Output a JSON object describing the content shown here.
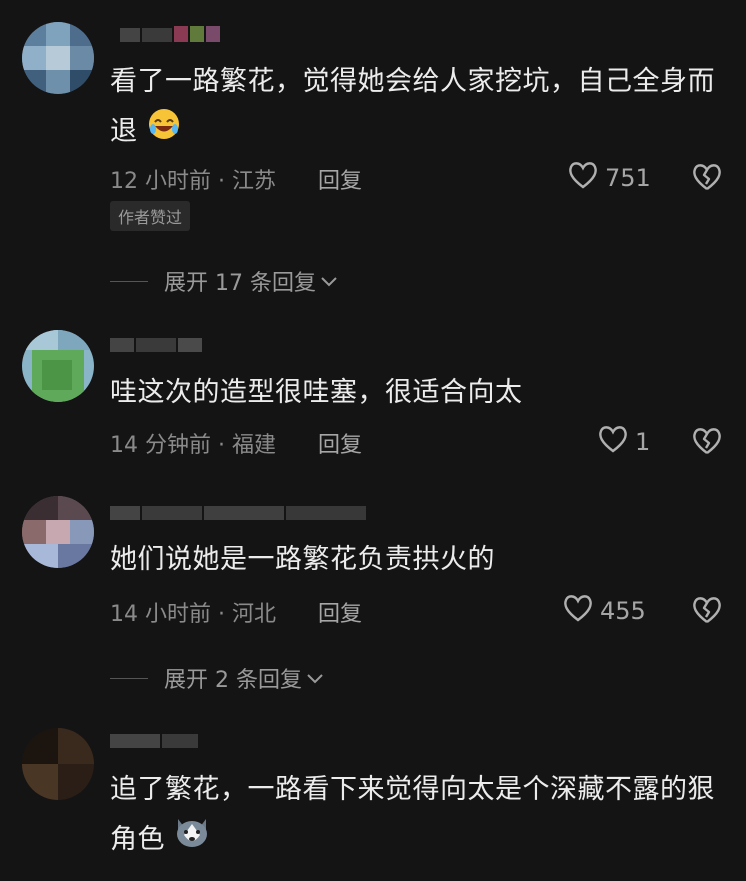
{
  "comments": [
    {
      "text": "看了一路繁花，觉得她会给人家挖坑，自己全身而退",
      "emoji": "rolling-laughing-emoji",
      "time": "12 小时前 · 江苏",
      "reply_label": "回复",
      "likes": "751",
      "badge": "作者赞过",
      "expand_label": "展开 17 条回复"
    },
    {
      "text": "哇这次的造型很哇塞，很适合向太",
      "time": "14 分钟前 · 福建",
      "reply_label": "回复",
      "likes": "1"
    },
    {
      "text": "她们说她是一路繁花负责拱火的",
      "time": "14 小时前 · 河北",
      "reply_label": "回复",
      "likes": "455",
      "expand_label": "展开 2 条回复"
    },
    {
      "text": "追了繁花，一路看下来觉得向太是个深藏不露的狠角色",
      "emoji": "husky-dog-emoji",
      "time": "",
      "reply_label": ""
    }
  ],
  "colors": {
    "background": "#141414",
    "text": "#ececec",
    "meta": "#8a8a8a"
  }
}
